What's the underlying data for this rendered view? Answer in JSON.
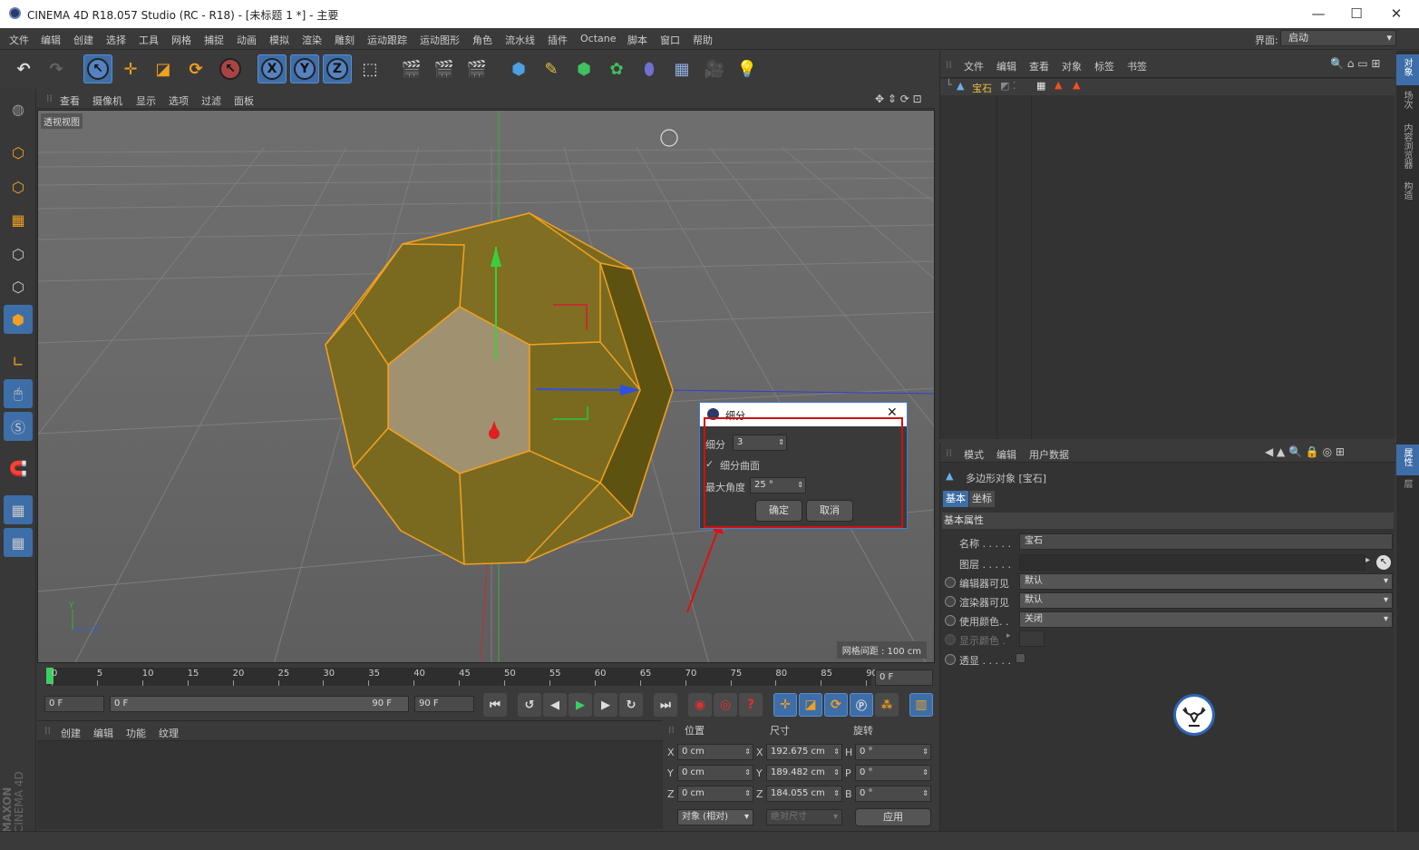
{
  "window": {
    "title": "CINEMA 4D R18.057 Studio (RC - R18) - [未标题 1 *] - 主要"
  },
  "menubar": [
    "文件",
    "编辑",
    "创建",
    "选择",
    "工具",
    "网格",
    "捕捉",
    "动画",
    "模拟",
    "渲染",
    "雕刻",
    "运动跟踪",
    "运动图形",
    "角色",
    "流水线",
    "插件",
    "Octane",
    "脚本",
    "窗口",
    "帮助"
  ],
  "layout": {
    "label": "界面:",
    "value": "启动"
  },
  "viewport": {
    "menu": [
      "查看",
      "摄像机",
      "显示",
      "选项",
      "过滤",
      "面板"
    ],
    "label": "透视视图",
    "grid_spacing": "网格间距 : 100 cm"
  },
  "dialog": {
    "title": "细分",
    "subdivision_label": "细分",
    "subdivision_value": "3",
    "smooth_label": "细分曲面",
    "max_angle_label": "最大角度",
    "max_angle_value": "25 °",
    "ok": "确定",
    "cancel": "取消"
  },
  "timeline": {
    "ticks": [
      "0",
      "5",
      "10",
      "15",
      "20",
      "25",
      "30",
      "35",
      "40",
      "45",
      "50",
      "55",
      "60",
      "65",
      "70",
      "75",
      "80",
      "85",
      "90"
    ],
    "current": "0 F",
    "start": "0 F",
    "range_start": "0 F",
    "range_end": "90 F",
    "end": "90 F"
  },
  "materials": {
    "menu": [
      "创建",
      "编辑",
      "功能",
      "纹理"
    ]
  },
  "coords": {
    "headers": [
      "位置",
      "尺寸",
      "旋转"
    ],
    "rows": [
      {
        "axis": "X",
        "pos": "0 cm",
        "size_axis": "X",
        "size": "192.675 cm",
        "rot_axis": "H",
        "rot": "0 °"
      },
      {
        "axis": "Y",
        "pos": "0 cm",
        "size_axis": "Y",
        "size": "189.482 cm",
        "rot_axis": "P",
        "rot": "0 °"
      },
      {
        "axis": "Z",
        "pos": "0 cm",
        "size_axis": "Z",
        "size": "184.055 cm",
        "rot_axis": "B",
        "rot": "0 °"
      }
    ],
    "mode": "对象 (相对)",
    "size_mode": "绝对尺寸",
    "apply": "应用"
  },
  "objects": {
    "menu": [
      "文件",
      "编辑",
      "查看",
      "对象",
      "标签",
      "书签"
    ],
    "item": "宝石"
  },
  "attributes": {
    "menu": [
      "模式",
      "编辑",
      "用户数据"
    ],
    "object_title": "多边形对象 [宝石]",
    "tabs": [
      "基本",
      "坐标"
    ],
    "section": "基本属性",
    "fields": [
      {
        "label": "名称 . . . . .",
        "value": "宝石"
      },
      {
        "label": "图层 . . . . .",
        "value": ""
      },
      {
        "label": "编辑器可见",
        "value": "默认"
      },
      {
        "label": "渲染器可见",
        "value": "默认"
      },
      {
        "label": "使用颜色. .",
        "value": "关闭"
      },
      {
        "label": "显示颜色 .",
        "value": ""
      },
      {
        "label": "透显 . . . . .",
        "value": ""
      }
    ]
  },
  "right_tabs": [
    "对象",
    "场次",
    "内容浏览器",
    "构造",
    "属性",
    "层"
  ],
  "brand": {
    "line1": "MAXON",
    "line2": "CINEMA 4D"
  },
  "colors": {
    "accent_blue": "#3e6ea8",
    "gem_fill": "#7a6a20",
    "gem_edge": "#f0a020",
    "highlight_red": "#d01010"
  }
}
